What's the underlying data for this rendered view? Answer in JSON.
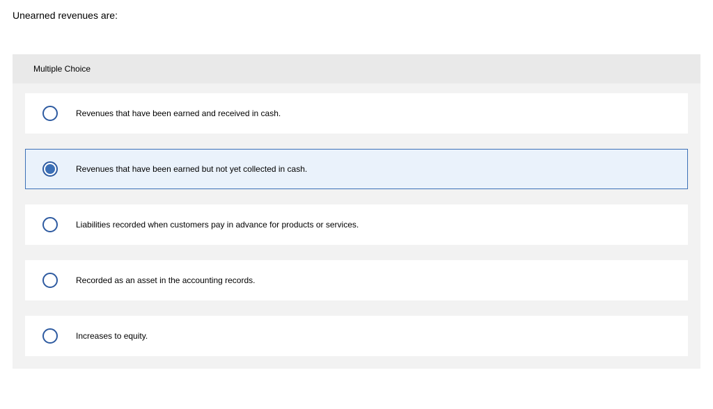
{
  "question": "Unearned revenues are:",
  "section_label": "Multiple Choice",
  "options": [
    {
      "label": "Revenues that have been earned and received in cash.",
      "selected": false
    },
    {
      "label": "Revenues that have been earned but not yet collected in cash.",
      "selected": true
    },
    {
      "label": "Liabilities recorded when customers pay in advance for products or services.",
      "selected": false
    },
    {
      "label": "Recorded as an asset in the accounting records.",
      "selected": false
    },
    {
      "label": "Increases to equity.",
      "selected": false
    }
  ]
}
